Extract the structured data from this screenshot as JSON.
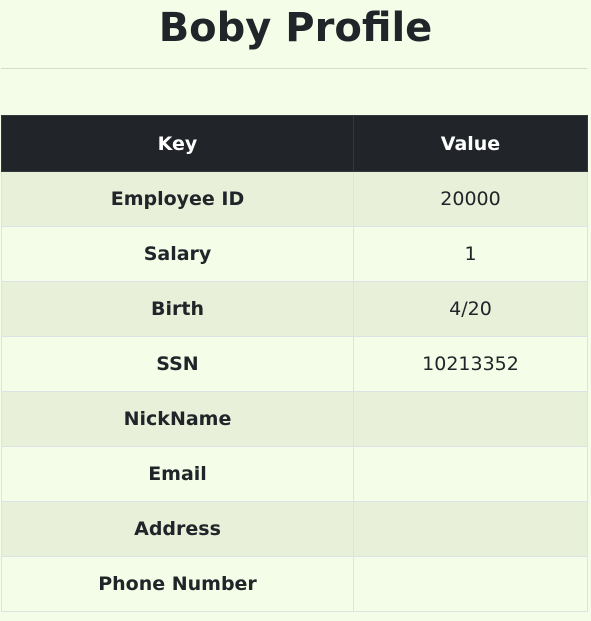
{
  "page": {
    "title": "Boby Profile"
  },
  "table": {
    "headers": {
      "key": "Key",
      "value": "Value"
    },
    "rows": [
      {
        "key": "Employee ID",
        "value": "20000"
      },
      {
        "key": "Salary",
        "value": "1"
      },
      {
        "key": "Birth",
        "value": "4/20"
      },
      {
        "key": "SSN",
        "value": "10213352"
      },
      {
        "key": "NickName",
        "value": ""
      },
      {
        "key": "Email",
        "value": ""
      },
      {
        "key": "Address",
        "value": ""
      },
      {
        "key": "Phone Number",
        "value": ""
      }
    ]
  },
  "colors": {
    "background": "#f3fde8",
    "header_bg": "#212529",
    "stripe": "#e8f0da"
  }
}
